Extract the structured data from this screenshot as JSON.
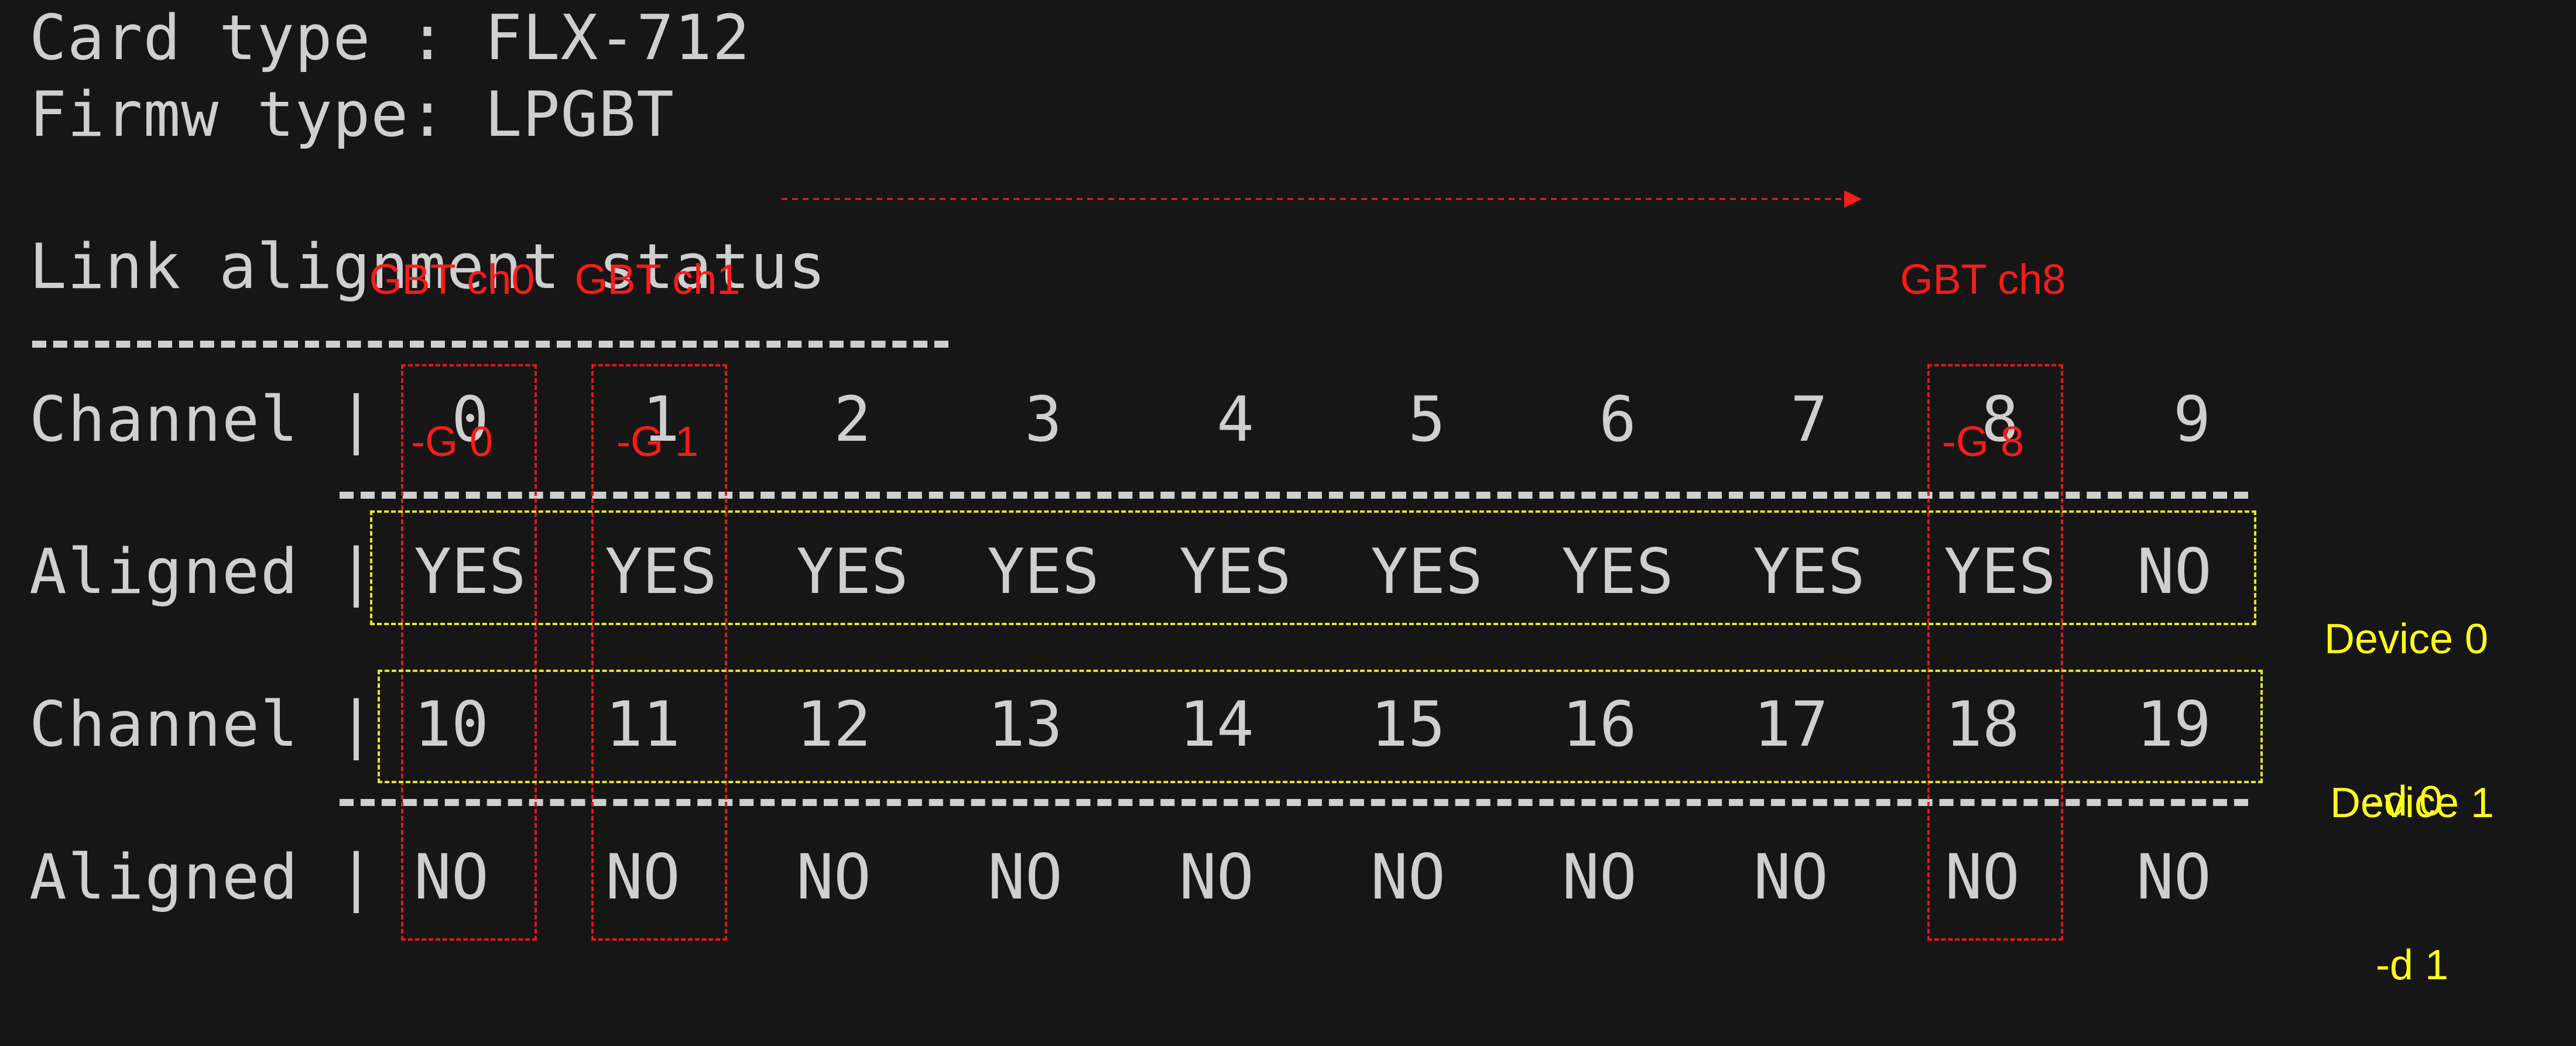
{
  "header": {
    "card_type": "Card type : FLX-712",
    "firmw_type": "Firmw type: LPGBT"
  },
  "section": {
    "title": "Link alignment status",
    "underline": "------------------------"
  },
  "table": {
    "channel_label": "Channel |",
    "aligned_label": "Aligned |",
    "rows": [
      {
        "channels": [
          "0",
          "1",
          "2",
          "3",
          "4",
          "5",
          "6",
          "7",
          "8",
          "9"
        ],
        "aligned": [
          "YES",
          "YES",
          "YES",
          "YES",
          "YES",
          "YES",
          "YES",
          "YES",
          "YES",
          "NO"
        ]
      },
      {
        "channels": [
          "10",
          "11",
          "12",
          "13",
          "14",
          "15",
          "16",
          "17",
          "18",
          "19"
        ],
        "aligned": [
          "NO",
          "NO",
          "NO",
          "NO",
          "NO",
          "NO",
          "NO",
          "NO",
          "NO",
          "NO"
        ]
      }
    ]
  },
  "annotations": {
    "gbt": [
      {
        "line1": "GBT ch0",
        "line2": "-G 0"
      },
      {
        "line1": "GBT ch1",
        "line2": "-G 1"
      },
      {
        "line1": "GBT ch8",
        "line2": "-G 8"
      }
    ],
    "devices": [
      {
        "line1": "Device 0",
        "line2": "-d 0"
      },
      {
        "line1": "Device 1",
        "line2": "-d 1"
      }
    ],
    "colors": {
      "red": "#ff1a1a",
      "yellow": "#ffff1a",
      "terminal_text": "#cfcfcf",
      "background": "#161616"
    }
  }
}
